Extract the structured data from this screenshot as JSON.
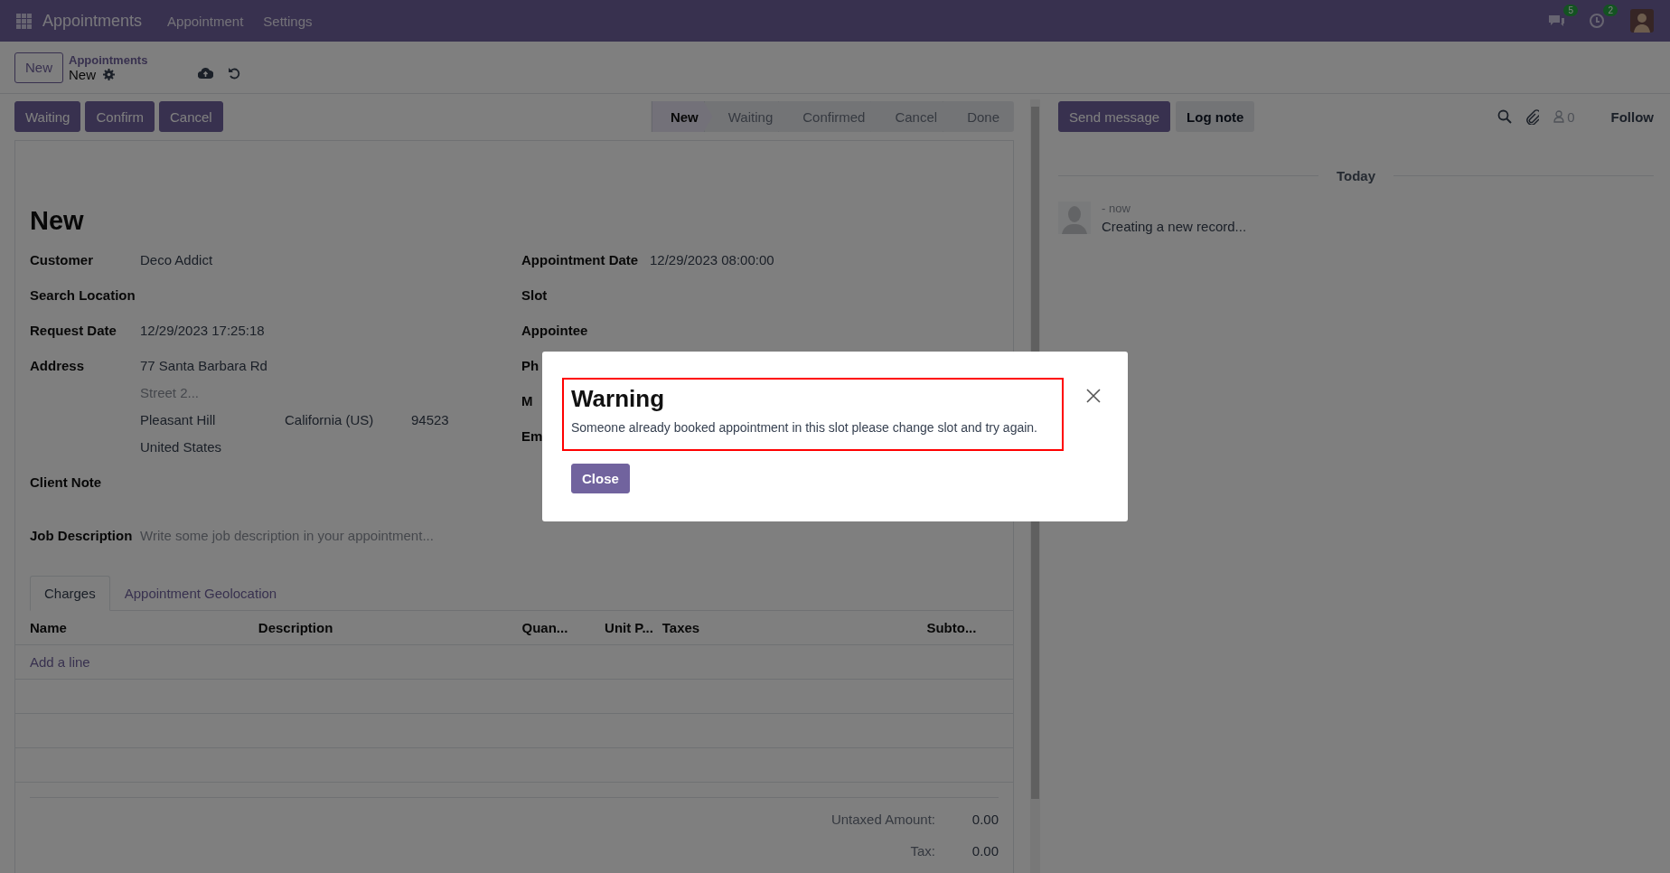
{
  "navbar": {
    "app_name": "Appointments",
    "menu": [
      "Appointment",
      "Settings"
    ],
    "systray": [
      {
        "kind": "chat",
        "badge": "5"
      },
      {
        "kind": "activity",
        "badge": "2"
      }
    ]
  },
  "control_panel": {
    "new_button": "New",
    "breadcrumb": "Appointments",
    "record": "New"
  },
  "action_buttons": [
    "Waiting",
    "Confirm",
    "Cancel"
  ],
  "statusbar": [
    {
      "label": "New",
      "selected": true
    },
    {
      "label": "Waiting",
      "selected": false
    },
    {
      "label": "Confirmed",
      "selected": false
    },
    {
      "label": "Cancel",
      "selected": false
    },
    {
      "label": "Done",
      "selected": false
    }
  ],
  "form": {
    "title": "New",
    "left_fields": [
      {
        "kind": "text",
        "label": "Customer",
        "value": "Deco Addict"
      },
      {
        "kind": "text",
        "label": "Search Location"
      },
      {
        "kind": "text",
        "label": "Request Date",
        "value": "12/29/2023 17:25:18"
      },
      {
        "kind": "address",
        "label": "Address",
        "street": "77 Santa Barbara Rd",
        "street2_placeholder": "Street 2...",
        "city": "Pleasant Hill",
        "state": "California (US)",
        "zip": "94523",
        "country": "United States"
      },
      {
        "kind": "text",
        "label": "Client Note"
      }
    ],
    "right_fields": [
      {
        "label": "Appointment Date",
        "value": "12/29/2023 08:00:00"
      },
      {
        "label": "Slot"
      },
      {
        "label": "Appointee"
      },
      {
        "label": "Ph"
      },
      {
        "label": "M"
      },
      {
        "label": "Em"
      }
    ],
    "job_description": {
      "label": "Job Description",
      "placeholder": "Write some job description in your appointment..."
    },
    "tabs": [
      {
        "label": "Charges",
        "selected": true
      },
      {
        "label": "Appointment Geolocation",
        "selected": false
      }
    ],
    "table": {
      "columns": [
        "Name",
        "Description",
        "Quan...",
        "Unit P...",
        "Taxes",
        "Subto..."
      ],
      "add_line": "Add a line"
    },
    "totals": [
      {
        "label": "Untaxed Amount:",
        "value": "0.00"
      },
      {
        "label": "Tax:",
        "value": "0.00"
      }
    ]
  },
  "chatter": {
    "buttons": [
      {
        "label": "Send message",
        "kind": "primary"
      },
      {
        "label": "Log note",
        "kind": "secondary"
      }
    ],
    "followers": "0",
    "follow": "Follow",
    "date_separator": "Today",
    "messages": [
      {
        "time": "- now",
        "body": "Creating a new record..."
      }
    ]
  },
  "dialog": {
    "title": "Warning",
    "message": "Someone already booked appointment in this slot please change slot and try again.",
    "close_button": "Close"
  }
}
